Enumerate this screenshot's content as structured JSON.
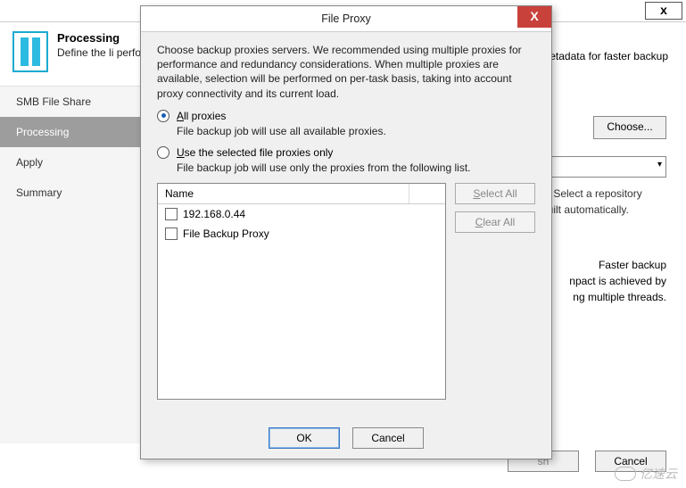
{
  "wizard": {
    "close_glyph": "x",
    "header": {
      "title": "Processing",
      "subtitle_visible": "Define the li\nperformance",
      "tail1": "etadata for faster backup"
    },
    "steps": [
      "SMB File Share",
      "Processing",
      "Apply",
      "Summary"
    ],
    "active_step_index": 1,
    "choose_label": "Choose...",
    "hint1": "d. Select a repository",
    "hint2": "built automatically.",
    "faster_title": "Faster backup",
    "faster_l1": "npact is achieved by",
    "faster_l2": "ng multiple threads.",
    "btn_sh_visible": "sh",
    "btn_cancel": "Cancel"
  },
  "modal": {
    "title": "File Proxy",
    "close_glyph": "X",
    "description": "Choose backup proxies servers. We recommended using multiple proxies for performance and redundancy considerations. When multiple proxies are available, selection will be performed on per-task basis, taking into account proxy connectivity and its current load.",
    "radio_all": {
      "label_pre": "",
      "label_u": "A",
      "label_post": "ll proxies",
      "checked": true,
      "sub": "File backup job will use all available proxies."
    },
    "radio_sel": {
      "label_pre": "",
      "label_u": "U",
      "label_post": "se the selected file proxies only",
      "checked": false,
      "sub": "File backup job will use only the proxies from the following list."
    },
    "list_header": "Name",
    "proxies": [
      "192.168.0.44",
      "File Backup Proxy"
    ],
    "select_all_u": "S",
    "select_all_rest": "elect All",
    "clear_all_u": "C",
    "clear_all_rest": "lear All",
    "ok": "OK",
    "cancel": "Cancel"
  },
  "watermark": "亿速云"
}
